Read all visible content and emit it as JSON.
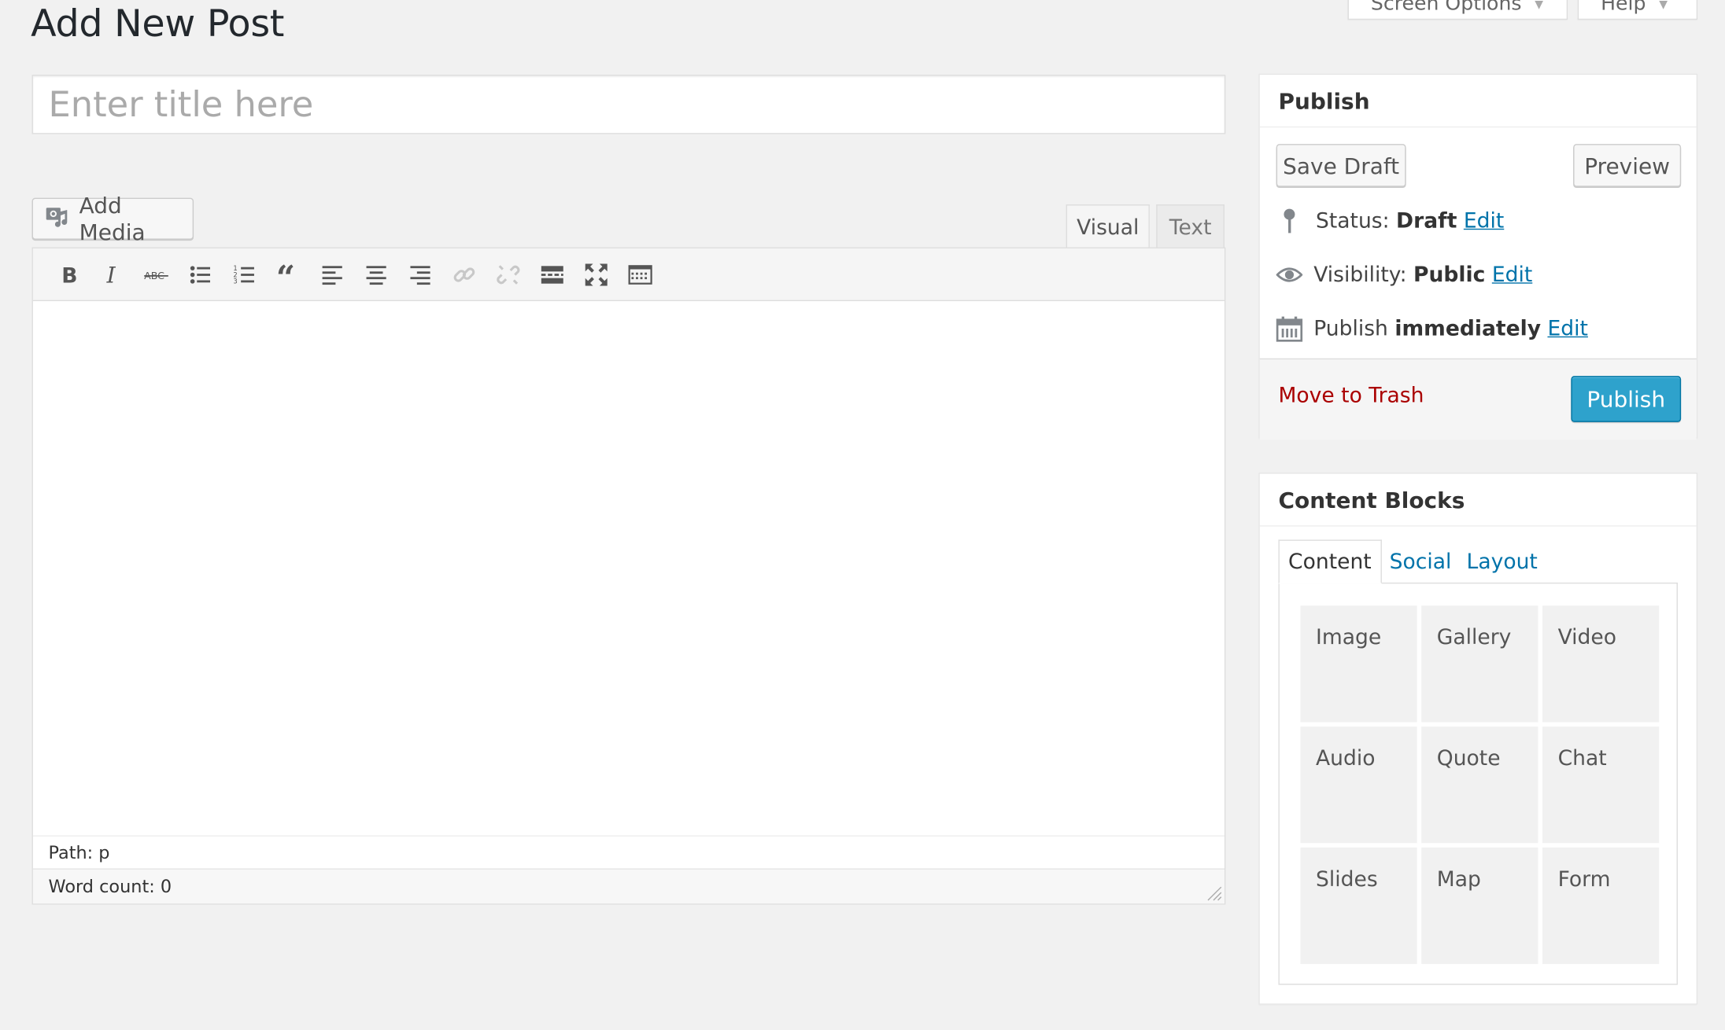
{
  "screen_meta": {
    "screen_options": "Screen Options",
    "help": "Help"
  },
  "page": {
    "title": "Add New Post"
  },
  "post_title": {
    "placeholder": "Enter title here"
  },
  "editor": {
    "add_media": "Add Media",
    "tabs": {
      "visual": "Visual",
      "text": "Text"
    },
    "toolbar": [
      "bold-icon",
      "italic-icon",
      "strikethrough-icon",
      "bulleted-list-icon",
      "numbered-list-icon",
      "blockquote-icon",
      "align-left-icon",
      "align-center-icon",
      "align-right-icon",
      "insert-link-icon",
      "unlink-icon",
      "read-more-icon",
      "fullscreen-icon",
      "toolbar-toggle-icon"
    ],
    "path": "Path: p",
    "word_count": "Word count: 0"
  },
  "publish": {
    "title": "Publish",
    "save_draft": "Save Draft",
    "preview": "Preview",
    "status_label": "Status:",
    "status_value": "Draft",
    "visibility_label": "Visibility:",
    "visibility_value": "Public",
    "schedule_label": "Publish",
    "schedule_value": "immediately",
    "edit": "Edit",
    "trash": "Move to Trash",
    "publish": "Publish",
    "colors": {
      "primary": "#2ea2cc",
      "trash": "#aa0000",
      "link": "#0073aa"
    }
  },
  "content_blocks": {
    "title": "Content Blocks",
    "tabs": [
      "Content",
      "Social",
      "Layout"
    ],
    "items": [
      "Image",
      "Gallery",
      "Video",
      "Audio",
      "Quote",
      "Chat",
      "Slides",
      "Map",
      "Form"
    ]
  }
}
